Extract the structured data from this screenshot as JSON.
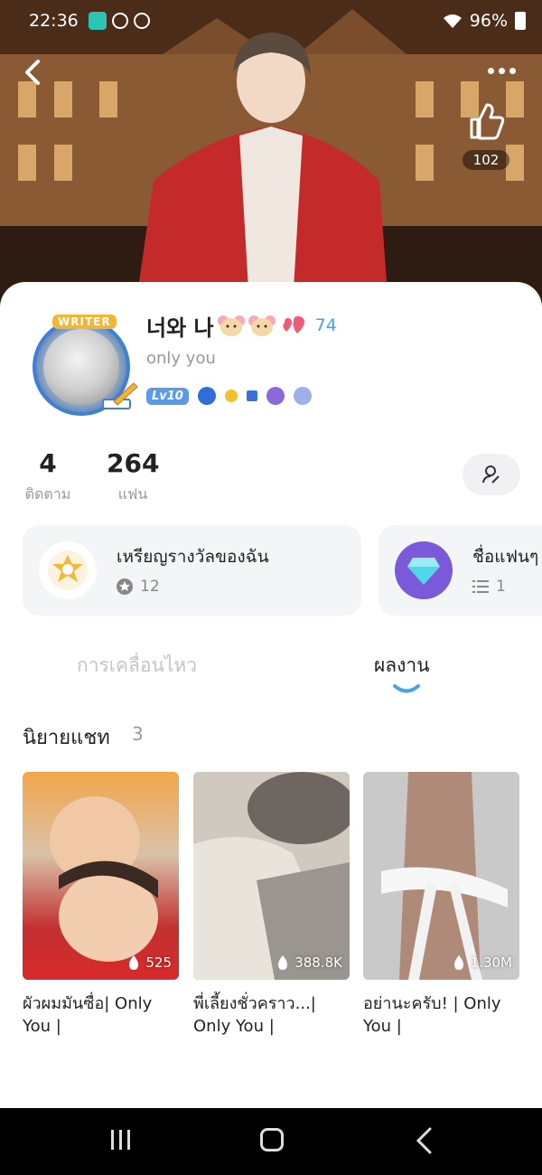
{
  "status_bar": {
    "time": "22:36",
    "battery": "96%"
  },
  "header": {
    "like_count": "102"
  },
  "profile": {
    "writer_tag": "WRITER",
    "name": "너와 나",
    "heart_count": "74",
    "bio": "only you",
    "level": "Lv10"
  },
  "stats": {
    "following_count": "4",
    "following_label": "ติดตาม",
    "fans_count": "264",
    "fans_label": "แฟน"
  },
  "cards": [
    {
      "title": "เหรียญรางวัลของฉัน",
      "count": "12"
    },
    {
      "title": "ชื่อแฟนๆ",
      "count": "1"
    }
  ],
  "tabs": [
    {
      "label": "การเคลื่อนไหว"
    },
    {
      "label": "ผลงาน"
    }
  ],
  "section": {
    "title": "นิยายแชท",
    "count": "3"
  },
  "stories": [
    {
      "views": "525",
      "title": "ผัวผมมันซื่อ| Only You |"
    },
    {
      "views": "388.8K",
      "title": "พี่เลี้ยงชั่วคราว...| Only You |"
    },
    {
      "views": "1.30M",
      "title": "อย่านะครับ! | Only You |"
    }
  ],
  "colors": {
    "accent": "#4aa3e8",
    "sheet_bg": "#ffffff",
    "card_bg": "#f4f5f7"
  }
}
